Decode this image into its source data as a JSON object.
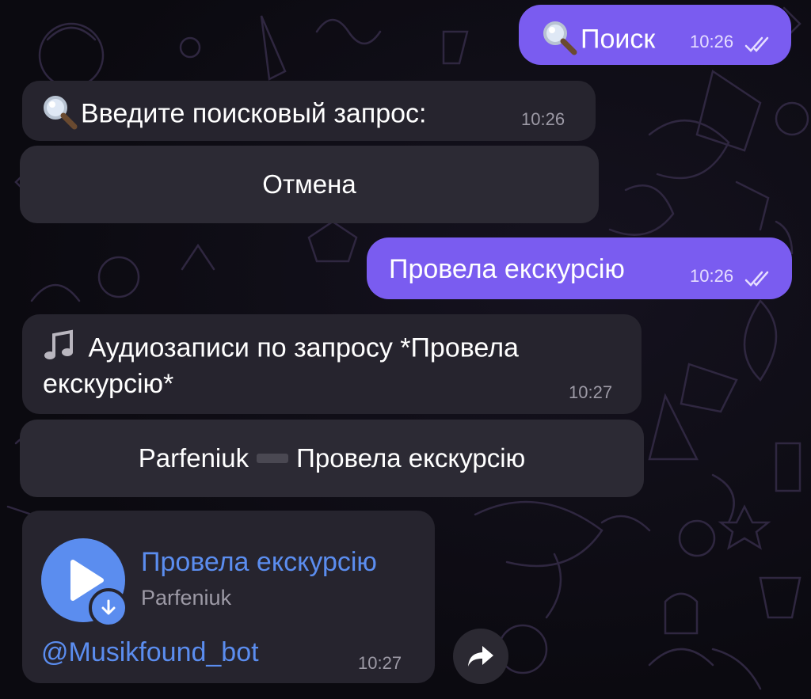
{
  "messages": [
    {
      "id": "m1",
      "dir": "out",
      "emoji": "search-icon",
      "text": "Поиск",
      "time": "10:26",
      "read": true
    },
    {
      "id": "m2",
      "dir": "in",
      "emoji": "search-icon",
      "text": "Введите поисковый запрос:",
      "time": "10:26"
    },
    {
      "id": "m4",
      "dir": "out",
      "text": "Провела екскурсію",
      "time": "10:26",
      "read": true
    },
    {
      "id": "m5",
      "dir": "in",
      "emoji": "musical-note-icon",
      "line1": "Аудиозаписи по запросу *Провела",
      "line2": "екскурсію*",
      "time": "10:27"
    }
  ],
  "keyboards": {
    "cancel": {
      "label": "Отмена"
    },
    "result": {
      "artist": "Parfeniuk",
      "title": "Провела екскурсію"
    }
  },
  "audio": {
    "title": "Провела екскурсію",
    "performer": "Parfeniuk",
    "via": "@Musikfound_bot",
    "time": "10:27",
    "colors": {
      "accent": "#5b8def"
    }
  },
  "theme": {
    "outgoing": "#7a5cf0",
    "incoming": "#26242e",
    "button": "#2c2a34"
  }
}
